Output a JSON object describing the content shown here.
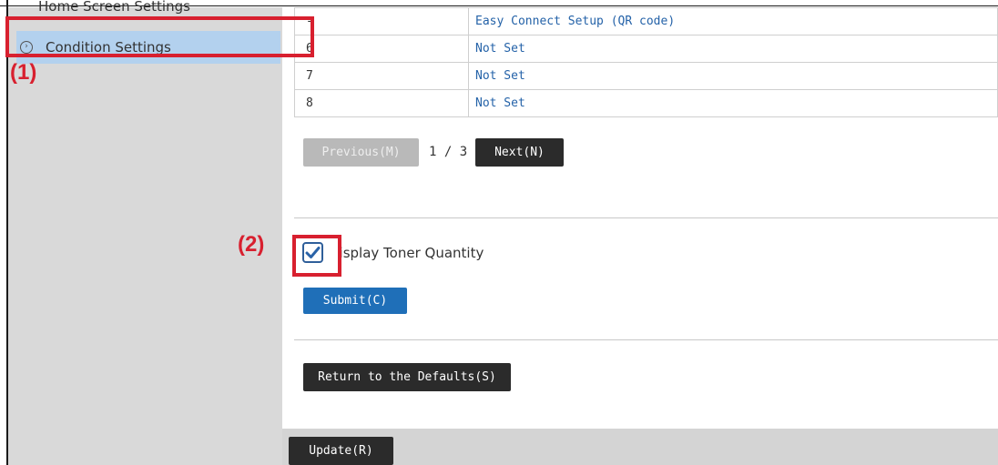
{
  "sidebar": {
    "items": [
      {
        "label": "Home Screen Settings"
      },
      {
        "label": "Condition Settings"
      }
    ]
  },
  "table": {
    "rows": [
      {
        "num": "-",
        "value": "Easy Connect Setup (QR code)"
      },
      {
        "num": "6",
        "value": "Not Set"
      },
      {
        "num": "7",
        "value": "Not Set"
      },
      {
        "num": "8",
        "value": "Not Set"
      }
    ]
  },
  "pagination": {
    "previous_label": "Previous(M)",
    "page_indicator": "1 / 3",
    "next_label": "Next(N)"
  },
  "toner": {
    "checkbox_label": "Display Toner Quantity",
    "checked": true
  },
  "buttons": {
    "submit": "Submit(C)",
    "defaults": "Return to the Defaults(S)",
    "update": "Update(R)"
  },
  "annotations": {
    "label_1": "(1)",
    "label_2": "(2)"
  },
  "colors": {
    "annotation_red": "#d8202f",
    "link_blue": "#2462a8",
    "selected_sidebar": "#b3d1ee",
    "submit_blue": "#1f6fb8"
  }
}
